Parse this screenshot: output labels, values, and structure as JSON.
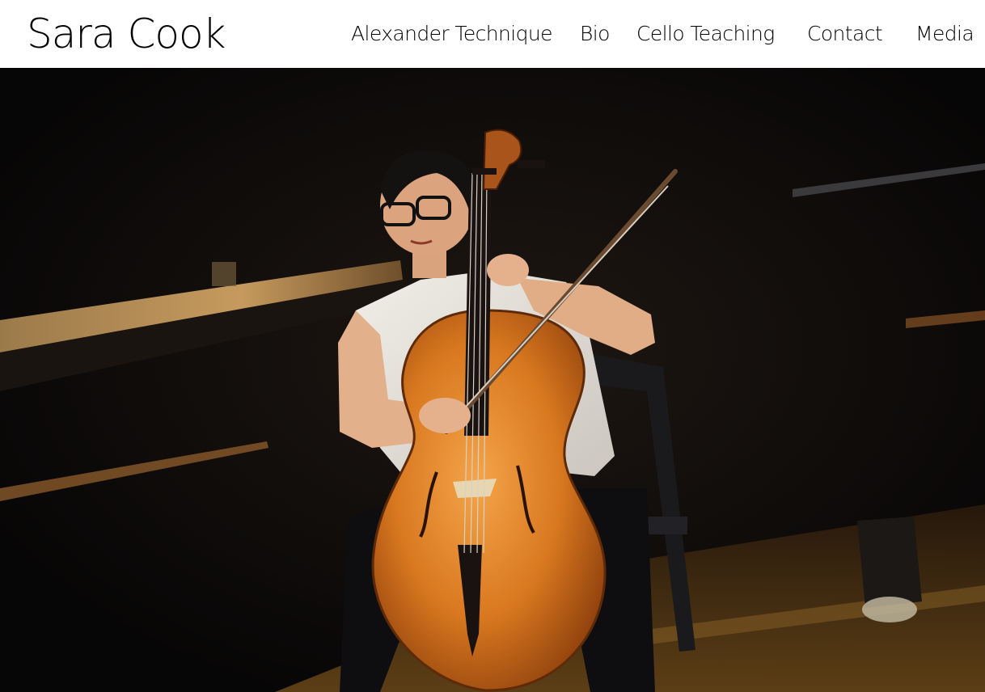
{
  "site": {
    "title": "Sara Cook"
  },
  "nav": {
    "items": [
      {
        "label": "Alexander Technique"
      },
      {
        "label": "Bio"
      },
      {
        "label": "Cello Teaching"
      },
      {
        "label": "Contact"
      },
      {
        "label": "Media"
      }
    ]
  },
  "colors": {
    "header_bg": "#ffffff",
    "text": "#000000",
    "hero_bg": "#0b0a0a"
  }
}
